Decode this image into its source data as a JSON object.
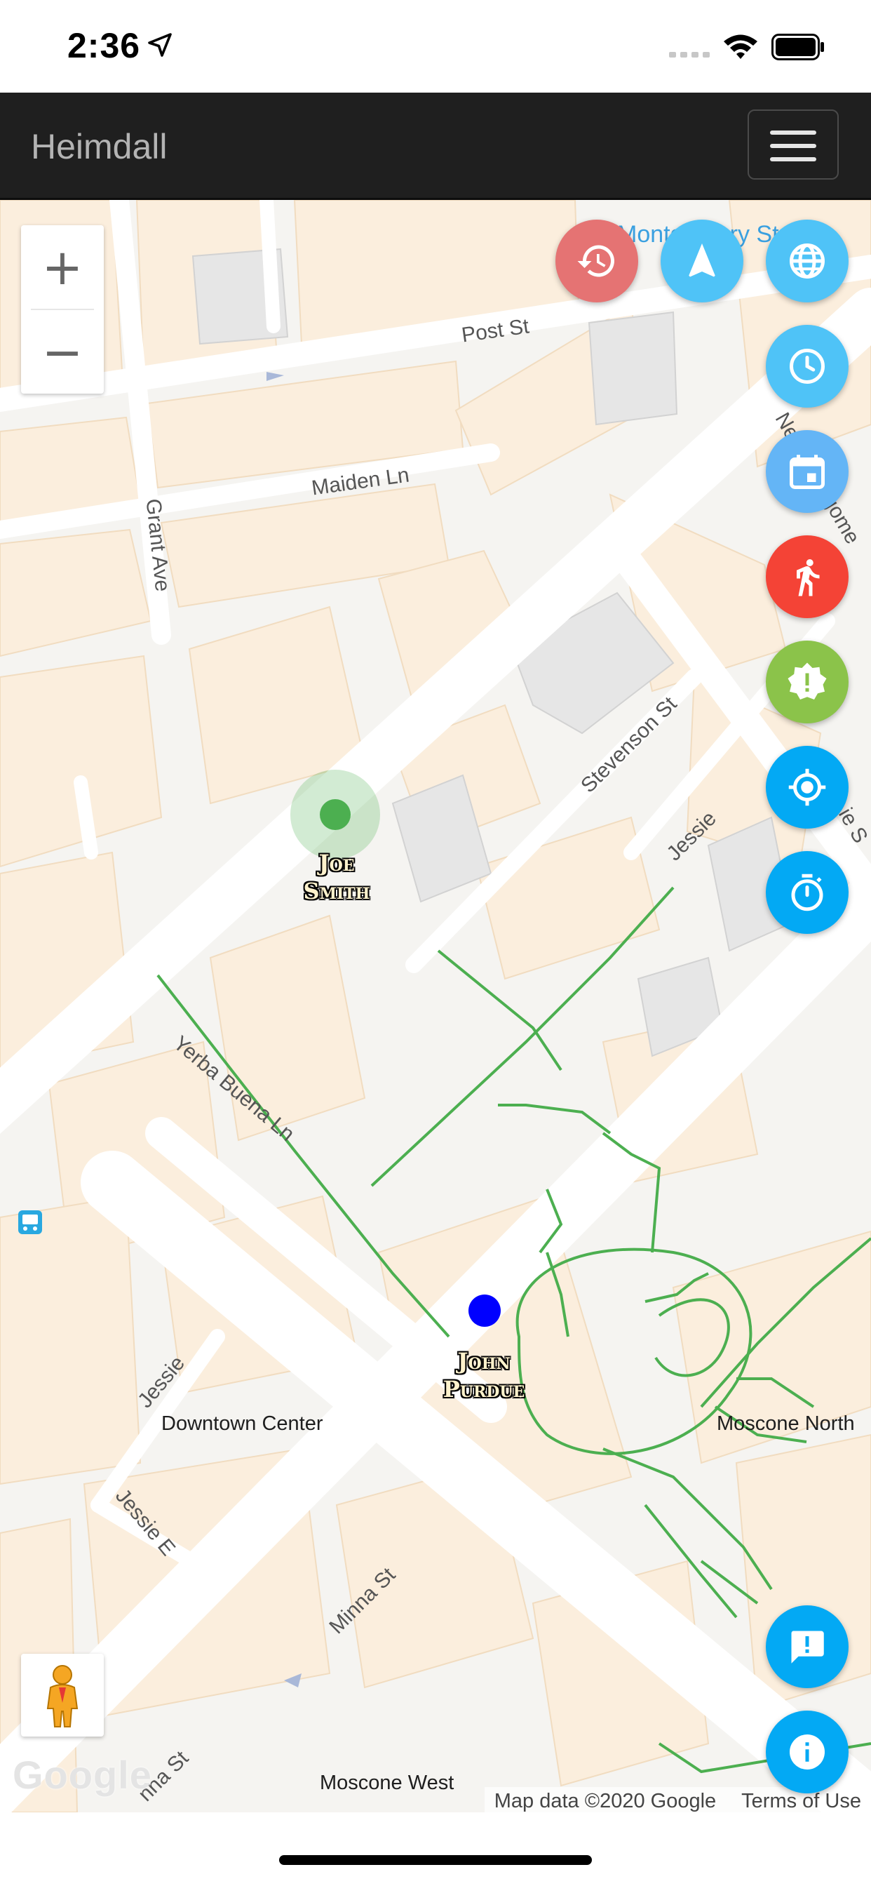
{
  "status_bar": {
    "time": "2:36"
  },
  "navbar": {
    "brand": "Heimdall",
    "menu_icon": "hamburger-menu-icon"
  },
  "map": {
    "street_labels": {
      "post_st": "Post St",
      "maiden_ln": "Maiden Ln",
      "grant_ave": "Grant Ave",
      "stevenson_st": "Stevenson St",
      "jessie_top": "Jessie",
      "yerba_buena_ln": "Yerba Buena Ln",
      "jessie_left": "Jessie",
      "jessie_e": "Jessie E",
      "minna_st": "Minna St",
      "minna_st_bottom": "nna St",
      "montgomery_street": "Montgomery Street",
      "new_montgomery": "New Montgome",
      "mission_partial": "ie S"
    },
    "poi_labels": {
      "downtown_center": "Downtown Center",
      "moscone_north": "Moscone North",
      "moscone_west": "Moscone West"
    },
    "markers": [
      {
        "name": "Joe Smith",
        "line1": "Joe",
        "line2": "Smith",
        "color": "#4caf50"
      },
      {
        "name": "John Purdue",
        "line1": "John",
        "line2": "Purdue",
        "color": "#0000ff"
      }
    ],
    "zoom": {
      "in": "+",
      "out": "−"
    },
    "logo": "Google",
    "attribution": {
      "data": "Map data ©2020 Google",
      "terms": "Terms of Use"
    }
  },
  "fabs": [
    {
      "name": "history-button",
      "icon": "history-icon",
      "color": "#e57373"
    },
    {
      "name": "navigate-button",
      "icon": "navigation-arrow-icon",
      "color": "#4fc3f7"
    },
    {
      "name": "globe-button",
      "icon": "globe-icon",
      "color": "#4fc3f7"
    },
    {
      "name": "clock-button",
      "icon": "clock-icon",
      "color": "#4fc3f7"
    },
    {
      "name": "calendar-button",
      "icon": "calendar-icon",
      "color": "#64b5f6"
    },
    {
      "name": "walking-button",
      "icon": "walking-person-icon",
      "color": "#f44336"
    },
    {
      "name": "alert-badge-button",
      "icon": "alert-badge-icon",
      "color": "#8bc34a"
    },
    {
      "name": "locate-button",
      "icon": "crosshair-location-icon",
      "color": "#03a9f4"
    },
    {
      "name": "timer-button",
      "icon": "stopwatch-icon",
      "color": "#03a9f4"
    },
    {
      "name": "feedback-button",
      "icon": "feedback-icon",
      "color": "#03a9f4"
    },
    {
      "name": "info-button",
      "icon": "info-icon",
      "color": "#03a9f4"
    }
  ]
}
